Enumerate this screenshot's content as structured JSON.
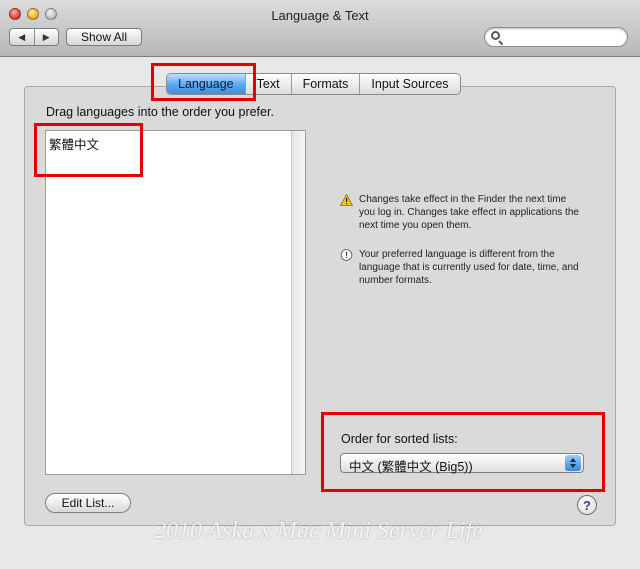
{
  "window": {
    "title": "Language & Text"
  },
  "toolbar": {
    "back_icon": "back-arrow-icon",
    "forward_icon": "forward-arrow-icon",
    "show_all_label": "Show All",
    "search_value": "",
    "search_placeholder": ""
  },
  "tabs": [
    {
      "label": "Language",
      "active": true
    },
    {
      "label": "Text",
      "active": false
    },
    {
      "label": "Formats",
      "active": false
    },
    {
      "label": "Input Sources",
      "active": false
    }
  ],
  "language_panel": {
    "instruction": "Drag languages into the order you prefer.",
    "languages": [
      "繁體中文"
    ],
    "edit_list_label": "Edit List..."
  },
  "notes": [
    {
      "icon": "warning-icon",
      "text": "Changes take effect in the Finder the next time you log in. Changes take effect in applications the next time you open them."
    },
    {
      "icon": "info-icon",
      "text": "Your preferred language is different from the language that is currently used for date, time, and number formats."
    }
  ],
  "sorting": {
    "label": "Order for sorted lists:",
    "selected": "中文 (繁體中文 (Big5))"
  },
  "watermark": "2010 Aska x Mac Mini Server  Life",
  "colors": {
    "highlight": "#e60000",
    "active_tab": "#5aa5ec"
  }
}
